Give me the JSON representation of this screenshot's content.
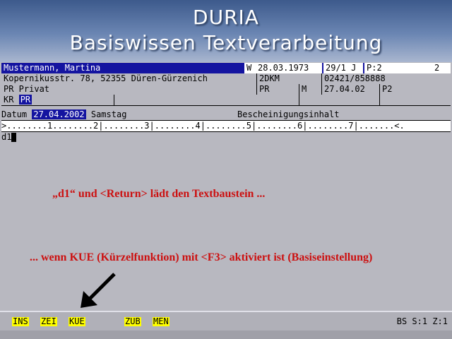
{
  "banner": {
    "app_name": "DURIA",
    "subtitle": "Basiswissen Textverarbeitung"
  },
  "record": {
    "name": "Mustermann, Martina",
    "sex": "W",
    "birthdate": "28.03.1973",
    "age_code": "29/1 J",
    "page": "P:2",
    "page_num": "2",
    "address": "Kopernikusstr. 78, 52355 Düren-Gürzenich",
    "doctor_code": "2DKM",
    "phone": "02421/858888",
    "insurance": "PR Privat",
    "ins_short": "PR",
    "ins_m": "M",
    "ins_date": "27.04.02",
    "ins_p": "P2",
    "kr_label": "KR",
    "kr_value": "PR"
  },
  "datum": {
    "label": "Datum",
    "date": "27.04.2002",
    "weekday": "Samstag",
    "content_label": "Bescheinigungsinhalt"
  },
  "ruler": ">........1........2|........3|........4|........5|........6|........7|.......<.",
  "editor": {
    "text": "d1"
  },
  "annotations": {
    "line1": "„d1“ und <Return> lädt den Textbaustein ...",
    "line2": "... wenn KUE (Kürzelfunktion) mit <F3> aktiviert ist (Basiseinstellung)"
  },
  "status": {
    "keys": [
      "INS",
      "ZEI",
      "KUE",
      "ZUB",
      "MEN"
    ],
    "right": "BS S:1 Z:1"
  },
  "colors": {
    "accent": "#1414a0",
    "annotation": "#cc1010",
    "function_key": "#ffff00"
  }
}
